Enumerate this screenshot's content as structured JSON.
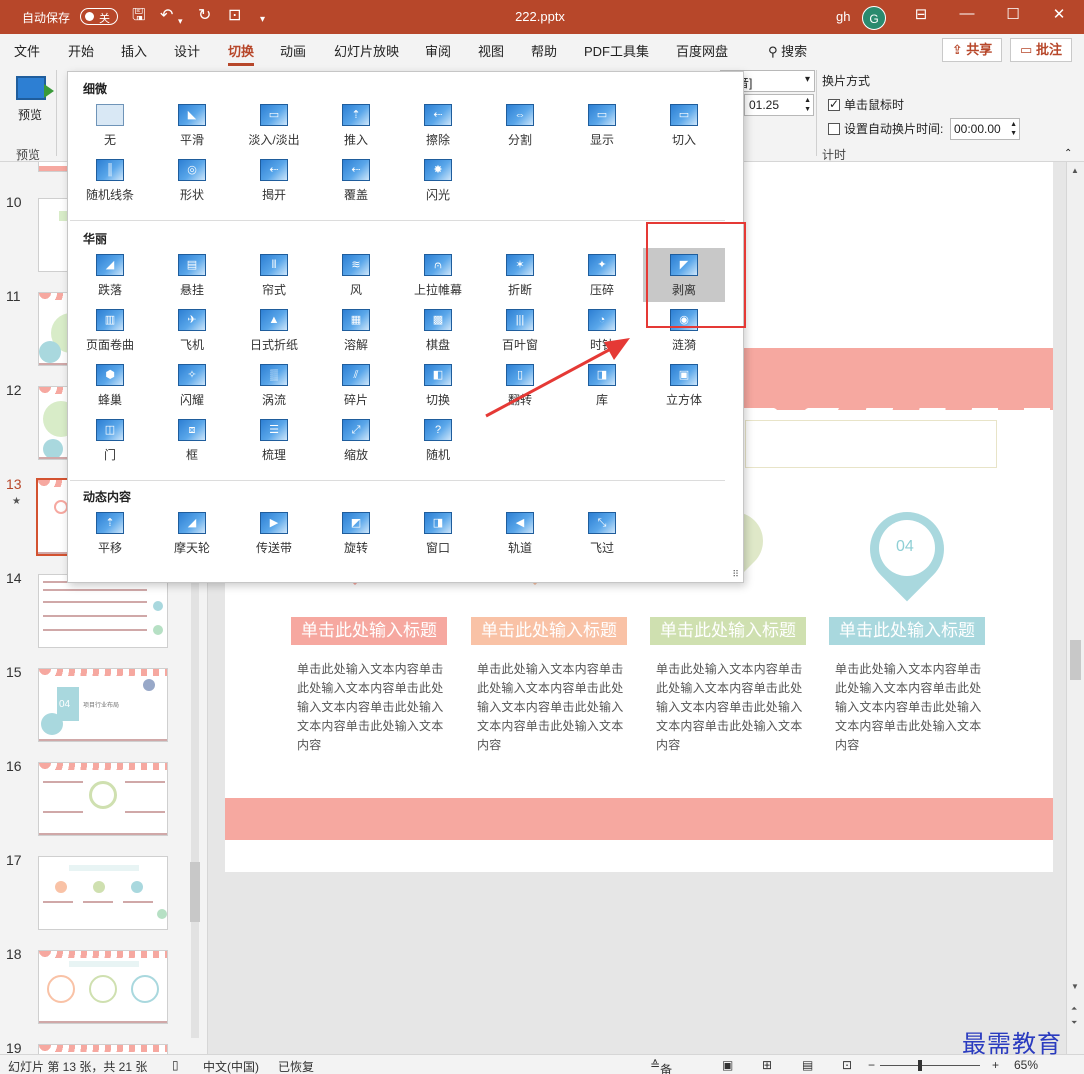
{
  "titlebar": {
    "autosave_label": "自动保存",
    "autosave_state": "关",
    "doc_title": "222.pptx",
    "user": "gh",
    "avatar_letter": "G"
  },
  "menu": {
    "tabs": [
      "文件",
      "开始",
      "插入",
      "设计",
      "切换",
      "动画",
      "幻灯片放映",
      "审阅",
      "视图",
      "帮助",
      "PDF工具集",
      "百度网盘"
    ],
    "active_tab": "切换",
    "search": "搜索",
    "share": "共享",
    "comment": "批注"
  },
  "ribbon": {
    "preview_label": "预览",
    "preview_group": "预览",
    "sound_value": "声音]",
    "duration_value": "01.25",
    "advance_title": "换片方式",
    "on_click_label": "单击鼠标时",
    "on_click_checked": true,
    "after_label": "设置自动换片时间:",
    "after_checked": false,
    "after_value": "00:00.00",
    "timing_group": "计时"
  },
  "gallery": {
    "sections": [
      {
        "title": "细微",
        "items": [
          "无",
          "平滑",
          "淡入/淡出",
          "推入",
          "擦除",
          "分割",
          "显示",
          "切入",
          "随机线条",
          "形状",
          "揭开",
          "覆盖",
          "闪光"
        ]
      },
      {
        "title": "华丽",
        "items": [
          "跌落",
          "悬挂",
          "帘式",
          "风",
          "上拉帷幕",
          "折断",
          "压碎",
          "剥离",
          "页面卷曲",
          "飞机",
          "日式折纸",
          "溶解",
          "棋盘",
          "百叶窗",
          "时钟",
          "涟漪",
          "蜂巢",
          "闪耀",
          "涡流",
          "碎片",
          "切换",
          "翻转",
          "库",
          "立方体",
          "门",
          "框",
          "梳理",
          "缩放",
          "随机"
        ]
      },
      {
        "title": "动态内容",
        "items": [
          "平移",
          "摩天轮",
          "传送带",
          "旋转",
          "窗口",
          "轨道",
          "飞过"
        ]
      }
    ],
    "selected": "剥离"
  },
  "thumbnails": {
    "numbers": [
      "10",
      "11",
      "12",
      "13",
      "14",
      "15",
      "16",
      "17",
      "18",
      "19"
    ],
    "current": "13",
    "thumb15_badge": "04",
    "thumb15_text": "项目行业布局"
  },
  "slide": {
    "pin_number": "04",
    "columns": [
      {
        "title": "单击此处输入标题",
        "color": "#f6a8a0",
        "body": "单击此处输入文本内容单击此处输入文本内容单击此处输入文本内容单击此处输入文本内容单击此处输入文本内容"
      },
      {
        "title": "单击此处输入标题",
        "color": "#f9c2a6",
        "body": "单击此处输入文本内容单击此处输入文本内容单击此处输入文本内容单击此处输入文本内容单击此处输入文本内容"
      },
      {
        "title": "单击此处输入标题",
        "color": "#cfe0b0",
        "body": "单击此处输入文本内容单击此处输入文本内容单击此处输入文本内容单击此处输入文本内容单击此处输入文本内容"
      },
      {
        "title": "单击此处输入标题",
        "color": "#a9d8de",
        "body": "单击此处输入文本内容单击此处输入文本内容单击此处输入文本内容单击此处输入文本内容单击此处输入文本内容"
      }
    ]
  },
  "status": {
    "slide_info": "幻灯片 第 13 张，共 21 张",
    "language": "中文(中国)",
    "recovered": "已恢复",
    "notes": "备注",
    "zoom": "65%"
  },
  "watermark": "最需教育",
  "colors": {
    "accent": "#b7472a",
    "annotation": "#e53935",
    "slide_pink": "#f6a8a0"
  }
}
